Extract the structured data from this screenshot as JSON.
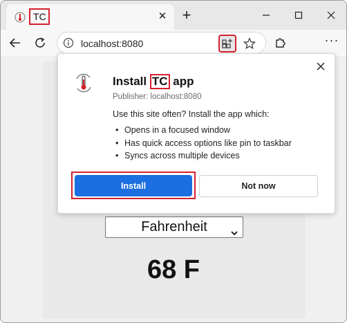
{
  "tab": {
    "title": "TC",
    "favicon": "thermometer-icon"
  },
  "address_bar": {
    "url": "localhost:8080"
  },
  "page": {
    "unit_selected": "Fahrenheit",
    "temperature": "68 F"
  },
  "install_dialog": {
    "title_prefix": "Install ",
    "title_app": "TC",
    "title_suffix": " app",
    "publisher": "Publisher: localhost:8080",
    "prompt": "Use this site often? Install the app which:",
    "features": [
      "Opens in a focused window",
      "Has quick access options like pin to taskbar",
      "Syncs across multiple devices"
    ],
    "install_label": "Install",
    "not_now_label": "Not now"
  },
  "colors": {
    "accent": "#1b6fe0",
    "highlight": "#d4202e"
  }
}
